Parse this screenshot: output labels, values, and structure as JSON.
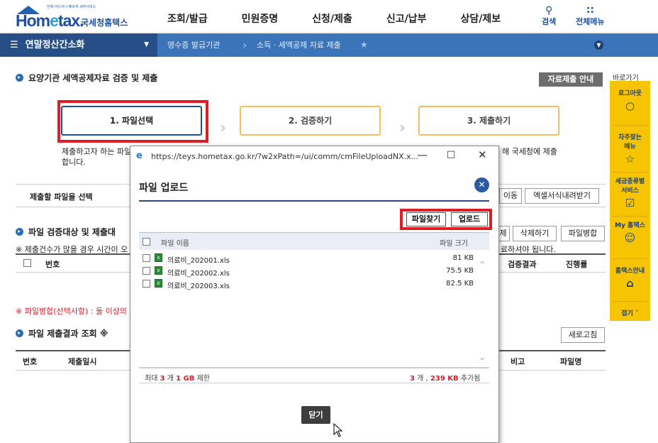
{
  "header": {
    "logo_tagline": "언제 어디서나 빠르게 세무서비스",
    "logo_brand_pre": "Hom",
    "logo_brand_e": "e",
    "logo_brand_post": "tax.",
    "logo_korean": "국세청홈택스",
    "menu": [
      "조회/발급",
      "민원증명",
      "신청/제출",
      "신고/납부",
      "상담/제보"
    ],
    "search_label": "검색",
    "all_menu_label": "전체메뉴"
  },
  "breadcrumb": {
    "current_menu": "연말정산간소화",
    "items": [
      "영수증 발급기관",
      "소득 · 세액공제 자료 제출"
    ]
  },
  "page": {
    "section_title": "요양기관 세액공제자료 검증 및 제출",
    "guide_button": "자료제출 안내",
    "steps": [
      "1. 파일선택",
      "2. 검증하기",
      "3. 제출하기"
    ],
    "desc_line1_left": "제출하고자 하는 파일",
    "desc_line1_right": "해 국세청에 제출",
    "desc_line2": "합니다.",
    "file_select_label": "제출할 파일을 선택",
    "move_button_fragment": "이동",
    "excel_download_button": "엑셀서식내려받기",
    "verify_section_title": "파일 검증대상 및 제출대",
    "verify_buttons_fragment": "제",
    "delete_button": "삭제하기",
    "merge_button": "파일병합",
    "notice_left": "※ 제출건수가 많을 경우 시간이 오",
    "notice_right": "료하셔야 됩니다.",
    "table1_headers": [
      "번호",
      "검증결과",
      "진행률"
    ],
    "merge_notice": "※ 파일병합(선택사항) : 둘 이상의",
    "result_section_title": "파일 제출결과 조회",
    "result_section_mark": "※",
    "refresh_button": "새로고침",
    "table2_headers": [
      "번호",
      "제출일시",
      "비고",
      "파일명"
    ]
  },
  "quick_menu": {
    "label": "바로가기",
    "items": [
      "로그아웃",
      "자주찾는 메뉴",
      "세금종류별 서비스",
      "My 홈택스",
      "홈택스안내"
    ],
    "fold": "접기"
  },
  "popup": {
    "window_url": "https://teys.hometax.go.kr/?w2xPath=/ui/comm/cmFileUploadNX.x...",
    "title": "파일 업로드",
    "find_file_button": "파일찾기",
    "upload_button": "업로드",
    "col_filename": "파일 이름",
    "col_filesize": "파일 크기",
    "files": [
      {
        "name": "의료비_202001.xls",
        "size": "81 KB"
      },
      {
        "name": "의료비_202002.xls",
        "size": "75.5 KB"
      },
      {
        "name": "의료비_202003.xls",
        "size": "82.5 KB"
      }
    ],
    "limit_prefix": "최대",
    "limit_count": "3",
    "limit_mid": "개",
    "limit_size": "1 GB",
    "limit_suffix": "제한",
    "added_count": "3",
    "added_mid": "개 ,",
    "added_size": "239 KB",
    "added_suffix": "추가됨",
    "close_button": "닫기"
  }
}
